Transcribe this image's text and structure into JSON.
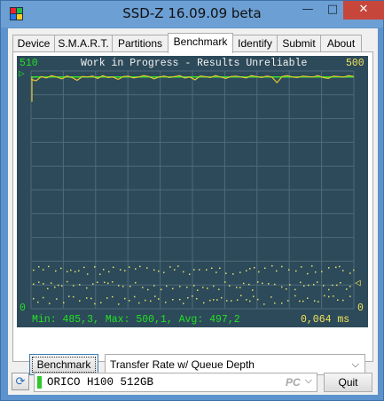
{
  "window": {
    "title": "SSD-Z 16.09.09 beta",
    "minimize_glyph": "—",
    "maximize_glyph": "□",
    "close_glyph": "✕"
  },
  "tabs": [
    {
      "label": "Device",
      "active": false
    },
    {
      "label": "S.M.A.R.T.",
      "active": false
    },
    {
      "label": "Partitions",
      "active": false
    },
    {
      "label": "Benchmark",
      "active": true
    },
    {
      "label": "Identify",
      "active": false
    },
    {
      "label": "Submit",
      "active": false
    },
    {
      "label": "About",
      "active": false
    }
  ],
  "benchmark": {
    "status_text": "Work in Progress - Results Unreliable",
    "y_max_left": "510",
    "y_max_right": "500",
    "y_min_left": "0",
    "y_min_right": "0",
    "stats_text": "Min: 485,3, Max: 500,1, Avg: 497,2",
    "latency_text": "0,064 ms",
    "top_marker": "▷",
    "right_marker": "◁",
    "button_label": "Benchmark",
    "mode_selected": "Transfer Rate w/ Queue Depth"
  },
  "drive": {
    "selected": "ORICO H100 512GB",
    "badge": "PC",
    "status_color": "#2ec72e",
    "quit_label": "Quit",
    "refresh_icon": "refresh-icon"
  },
  "colors": {
    "chart_background": "#2d4a5a",
    "grid": "#4f6b79",
    "transfer_line": "#e6c531",
    "avg_line": "#2ee02e",
    "dots": "#e8e36a"
  },
  "chart_data": {
    "type": "line",
    "title": "Work in Progress - Results Unreliable",
    "xlabel": "",
    "ylabel": "",
    "ylim": [
      0,
      510
    ],
    "series": [
      {
        "values": [
          492,
          489,
          498,
          495,
          500,
          497,
          493,
          499,
          496,
          490,
          498,
          497,
          499,
          494,
          500,
          496,
          497,
          492,
          498,
          499,
          495,
          497,
          500,
          498,
          493,
          497,
          499,
          496,
          498,
          500,
          495,
          497,
          491,
          499,
          498,
          496,
          500,
          497,
          494,
          498,
          499,
          497,
          495,
          500,
          498,
          496,
          499,
          497,
          485,
          498,
          500,
          497,
          496,
          499,
          498,
          497,
          500,
          496,
          494,
          499,
          498,
          497,
          500,
          498
        ]
      }
    ],
    "scatter_levels": [
      {
        "label": "",
        "y": 84
      },
      {
        "label": "",
        "y": 50
      },
      {
        "label": "",
        "y": 20
      }
    ],
    "stats": {
      "min": 485.3,
      "max": 500.1,
      "avg": 497.2,
      "latency_ms": 0.064
    }
  }
}
